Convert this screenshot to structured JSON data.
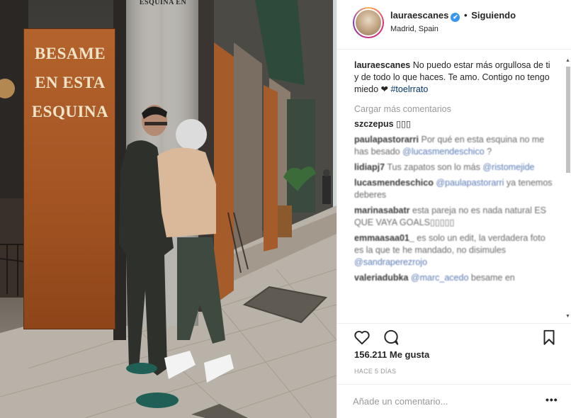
{
  "photo": {
    "sign_lines": [
      "BESAME",
      "EN ESTA",
      "ESQUINA"
    ],
    "wall_text": "ESQUINA EN"
  },
  "header": {
    "username": "lauraescanes",
    "verified_icon": "✔",
    "separator": "•",
    "follow_label": "Siguiendo",
    "location": "Madrid, Spain"
  },
  "caption": {
    "username": "lauraescanes",
    "text": "No puedo estar más orgullosa de ti y de todo lo que haces. Te amo. Contigo no tengo miedo ❤",
    "hashtag": "#toelrrato"
  },
  "load_more": "Cargar más comentarios",
  "comments": [
    {
      "user": "szczepus",
      "text": "▯▯▯",
      "mention": "",
      "after": "",
      "blurred": false
    },
    {
      "user": "paulapastorarri",
      "text": "Por qué en esta esquina no me has besado",
      "mention": "@lucasmendeschico",
      "after": "?",
      "blurred": true
    },
    {
      "user": "lidiapj7",
      "text": "Tus zapatos son lo más",
      "mention": "@ristomejide",
      "after": "",
      "blurred": true
    },
    {
      "user": "lucasmendeschico",
      "text": "",
      "mention": "@paulapastorarri",
      "after": "ya tenemos deberes",
      "blurred": true
    },
    {
      "user": "marinasabatr",
      "text": "esta pareja no es nada natural ES QUE VAYA GOALS▯▯▯▯▯",
      "mention": "",
      "after": "",
      "blurred": true
    },
    {
      "user": "emmaasaa01_",
      "text": "es solo un edit, la verdadera foto es la que te he mandado, no disimules",
      "mention": "@sandraperezrojo",
      "after": "",
      "blurred": true
    },
    {
      "user": "valeriadubka",
      "text": "",
      "mention": "@marc_acedo",
      "after": "besame en",
      "blurred": true
    }
  ],
  "likes": "156.211 Me gusta",
  "time": "HACE 5 DÍAS",
  "add_comment": {
    "placeholder": "Añade un comentario...",
    "more_label": "•••"
  },
  "colors": {
    "verified": "#3897f0",
    "link": "#003569",
    "muted": "#999999",
    "sign": "#a85a26"
  }
}
